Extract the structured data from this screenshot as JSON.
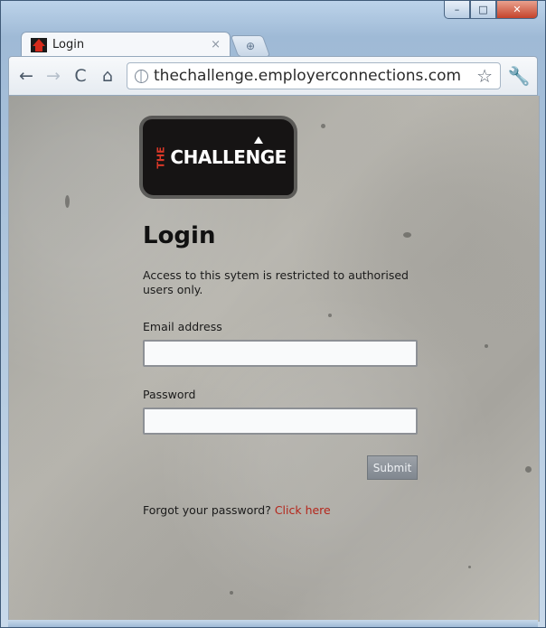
{
  "window": {
    "caption": {
      "minimize": "–",
      "maximize": "□",
      "close": "✕"
    }
  },
  "tab": {
    "title": "Login",
    "close": "×",
    "new_tab": "⊕"
  },
  "toolbar": {
    "back": "←",
    "forward": "→",
    "reload": "C",
    "home": "⌂",
    "url": "thechallenge.employerconnections.com",
    "star": "☆",
    "wrench": "🔧"
  },
  "page": {
    "logo": {
      "the": "THE",
      "challenge": "CHALLENGE"
    },
    "title": "Login",
    "notice": "Access to this sytem is restricted to authorised users only.",
    "email_label": "Email address",
    "email_value": "",
    "password_label": "Password",
    "password_value": "",
    "submit_label": "Submit",
    "forgot_text": "Forgot your password?",
    "forgot_link": "Click here"
  },
  "colors": {
    "link": "#b4261b",
    "accent": "#d83828"
  }
}
